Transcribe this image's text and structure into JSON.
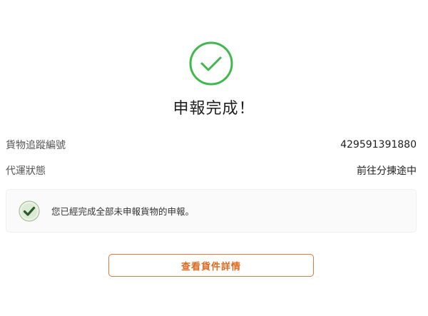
{
  "success": {
    "icon": "check-circle-icon",
    "title": "申報完成！",
    "color": "#3fb94d"
  },
  "info": {
    "tracking_label": "貨物追蹤編號",
    "tracking_value": "429591391880",
    "status_label": "代運狀態",
    "status_value": "前往分揀途中"
  },
  "notice": {
    "icon": "check-badge-icon",
    "text": "您已經完成全部未申報貨物的申報。"
  },
  "actions": {
    "details_label": "查看貨件詳情",
    "accent": "#e0691f"
  }
}
